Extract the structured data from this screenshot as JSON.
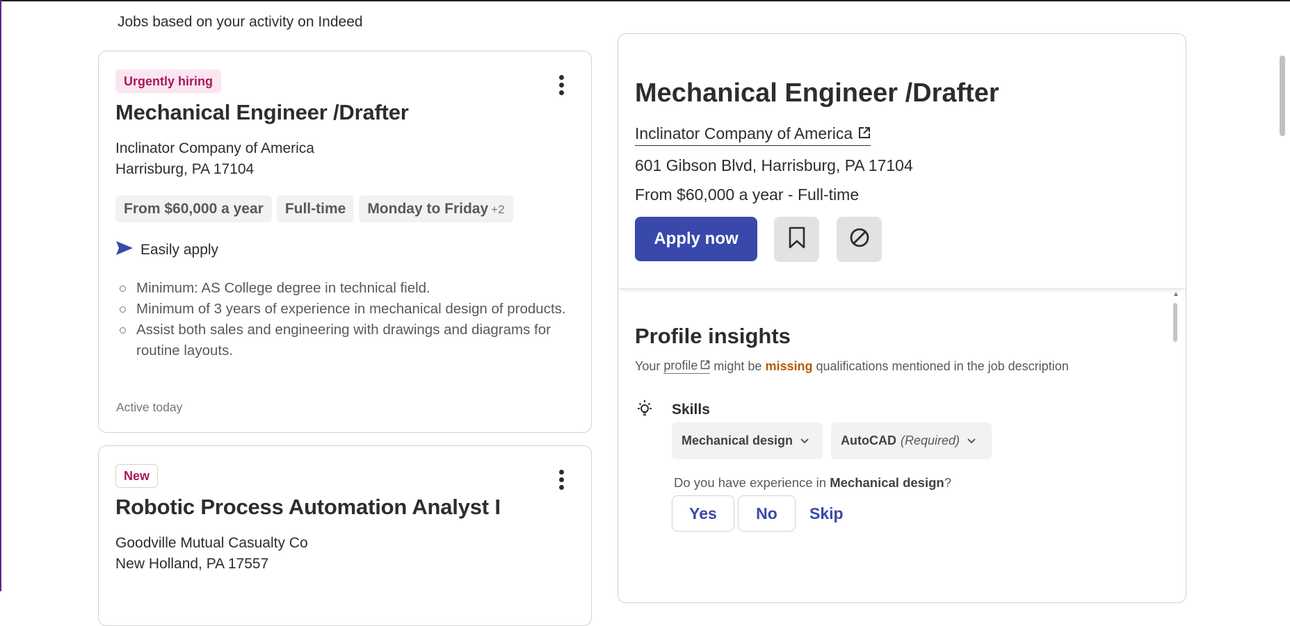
{
  "section_heading": "Jobs based on your activity on Indeed",
  "job_cards": [
    {
      "badge": "Urgently hiring",
      "title": "Mechanical Engineer /Drafter",
      "company": "Inclinator Company of America",
      "location": "Harrisburg, PA 17104",
      "tags": [
        "From $60,000 a year",
        "Full-time",
        "Monday to Friday"
      ],
      "tags_more": "+2",
      "easy_apply": "Easily apply",
      "bullets": [
        "Minimum: AS College degree in technical field.",
        "Minimum of 3 years of experience in mechanical design of products.",
        "Assist both sales and engineering with drawings and diagrams for routine layouts."
      ],
      "activity": "Active today"
    },
    {
      "badge": "New",
      "title": "Robotic Process Automation Analyst I",
      "company": "Goodville Mutual Casualty Co",
      "location": "New Holland, PA 17557"
    }
  ],
  "detail": {
    "title": "Mechanical Engineer /Drafter",
    "company": "Inclinator Company of America",
    "address": "601 Gibson Blvd, Harrisburg, PA 17104",
    "salary_type": "From $60,000 a year  - Full-time",
    "apply_label": "Apply now",
    "profile_insights": {
      "title": "Profile insights",
      "desc_prefix": "Your",
      "profile_link": "profile",
      "desc_mid": "might be",
      "missing": "missing",
      "desc_suffix": "qualifications mentioned in the job description",
      "skills_label": "Skills",
      "skill_chips": [
        {
          "name": "Mechanical design",
          "note": ""
        },
        {
          "name": "AutoCAD",
          "note": "(Required)"
        }
      ],
      "question_prefix": "Do you have experience in",
      "question_skill": "Mechanical design",
      "question_suffix": "?",
      "yes_label": "Yes",
      "no_label": "No",
      "skip_label": "Skip"
    }
  },
  "colors": {
    "accent": "#3949ab",
    "urgent_badge_bg": "#fbe6ef",
    "urgent_badge_text": "#a9185f",
    "missing_text": "#b45a00"
  },
  "icons": [
    "kebab-menu-icon",
    "send-icon",
    "external-link-icon",
    "bookmark-icon",
    "not-interested-icon",
    "lightbulb-icon",
    "chevron-down-icon"
  ]
}
